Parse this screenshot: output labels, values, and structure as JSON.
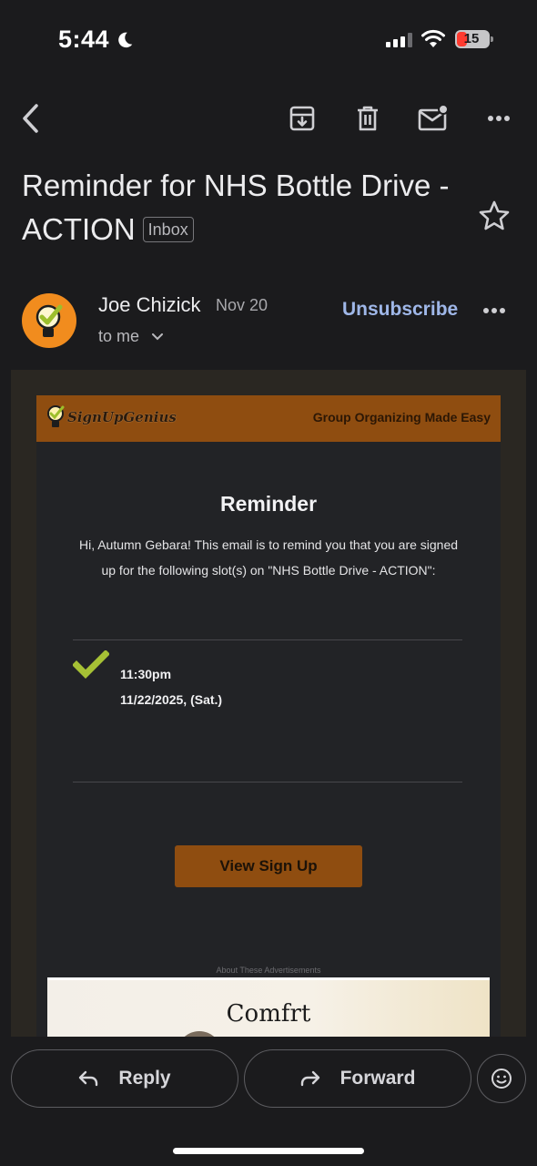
{
  "status_bar": {
    "time": "5:44",
    "battery": "15",
    "moon_icon": "moon-icon",
    "signal_icon": "cellular-signal-icon",
    "wifi_icon": "wifi-icon"
  },
  "toolbar": {
    "back_icon": "chevron-left-icon",
    "archive_icon": "archive-icon",
    "delete_icon": "trash-icon",
    "mark_unread_icon": "mail-unread-icon",
    "more_icon": "more-horizontal-icon"
  },
  "email": {
    "subject": "Reminder for NHS Bottle Drive - ACTION",
    "label": "Inbox",
    "sender_name": "Joe Chizick",
    "date": "Nov 20",
    "recipient": "to me",
    "unsubscribe": "Unsubscribe"
  },
  "body": {
    "brand": "SignUpGenius",
    "tagline": "Group Organizing Made Easy",
    "heading": "Reminder",
    "message": "Hi, Autumn Gebara! This email is to remind you that you are signed up for the following slot(s) on \"NHS Bottle Drive - ACTION\":",
    "slot_time": "11:30pm",
    "slot_date": "11/22/2025, (Sat.)",
    "button": "View Sign Up",
    "ad_label": "About These Advertisements",
    "ad_brand": "Comfrt"
  },
  "bottom_bar": {
    "reply": "Reply",
    "forward": "Forward",
    "emoji_icon": "smiley-icon"
  },
  "colors": {
    "background": "#1b1b1d",
    "accent_blue": "#9fb7e8",
    "brand_orange": "#8f4d10",
    "check_green": "#a6c135",
    "avatar_orange": "#f18c1e"
  }
}
